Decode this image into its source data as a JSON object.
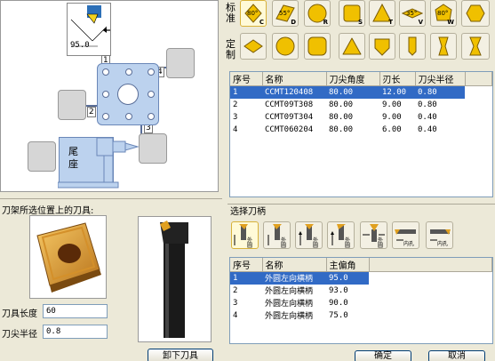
{
  "diagram": {
    "dim_value": "95.0",
    "position_numbers": [
      "1",
      "2",
      "3",
      "4"
    ],
    "tailstock_label": "尾座"
  },
  "inserts": {
    "standard_label": "标准",
    "custom_label": "定制",
    "standard_shapes": [
      {
        "letter": "C",
        "angle": "80°"
      },
      {
        "letter": "D",
        "angle": "55°"
      },
      {
        "letter": "R",
        "angle": ""
      },
      {
        "letter": "S",
        "angle": ""
      },
      {
        "letter": "T",
        "angle": ""
      },
      {
        "letter": "V",
        "angle": "35°"
      },
      {
        "letter": "W",
        "angle": "80°"
      }
    ]
  },
  "insert_table": {
    "headers": [
      "序号",
      "名称",
      "刀尖角度",
      "刃长",
      "刀尖半径"
    ],
    "rows": [
      [
        "1",
        "CCMT120408",
        "80.00",
        "12.00",
        "0.80"
      ],
      [
        "2",
        "CCMT09T308",
        "80.00",
        "9.00",
        "0.80"
      ],
      [
        "3",
        "CCMT09T304",
        "80.00",
        "9.00",
        "0.40"
      ],
      [
        "4",
        "CCMT060204",
        "80.00",
        "6.00",
        "0.40"
      ]
    ]
  },
  "tool_panel": {
    "title": "刀架所选位置上的刀具:",
    "length_label": "刀具长度",
    "length_value": "60",
    "radius_label": "刀尖半径",
    "radius_value": "0.8",
    "unload_button": "卸下刀具"
  },
  "holder_panel": {
    "title": "选择刀柄",
    "tool_labels": [
      "外圆",
      "外圆",
      "外圆",
      "外圆",
      "外圆",
      "内孔",
      "内孔"
    ],
    "headers": [
      "序号",
      "名称",
      "主偏角"
    ],
    "rows": [
      [
        "1",
        "外圆左向横柄",
        "95.0"
      ],
      [
        "2",
        "外圆左向横柄",
        "93.0"
      ],
      [
        "3",
        "外圆左向横柄",
        "90.0"
      ],
      [
        "4",
        "外圆左向横柄",
        "75.0"
      ]
    ]
  },
  "footer": {
    "ok_button": "确定",
    "cancel_button": "取消"
  },
  "colors": {
    "background": "#ece9d8",
    "selection": "#316ac5",
    "turret": "#bcd2ee",
    "insert_gold": "#e8a93a"
  }
}
